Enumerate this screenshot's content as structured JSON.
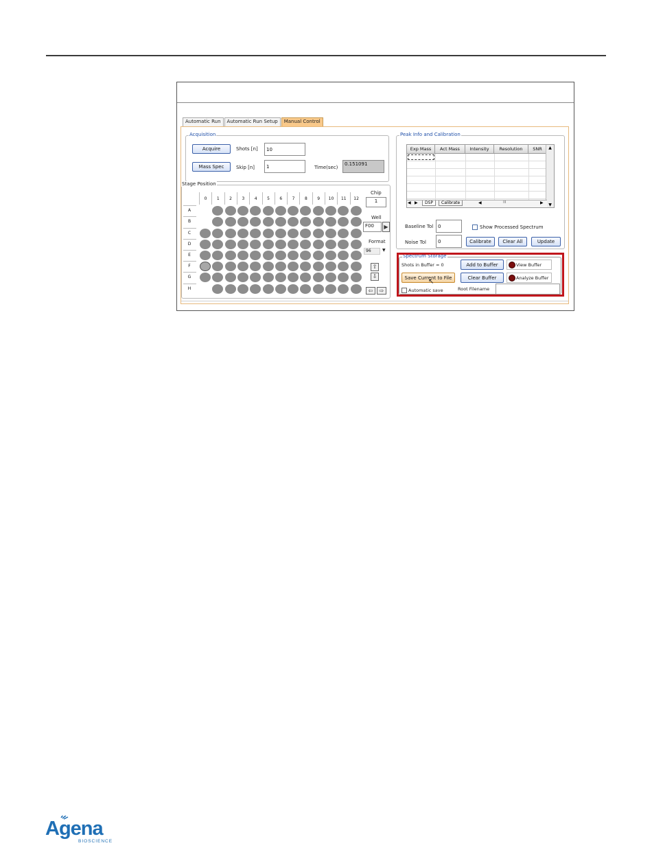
{
  "tabs": [
    "Automatic Run",
    "Automatic Run Setup",
    "Manual Control"
  ],
  "acquisition": {
    "title": "Acquisition",
    "acquire_label": "Acquire",
    "mass_spec_label": "Mass Spec",
    "shots_label": "Shots [n]",
    "shots_value": "10",
    "skip_label": "Skip [n]",
    "skip_value": "1",
    "time_label": "Time(sec)",
    "time_value": "0.151091"
  },
  "stage": {
    "title": "Stage Position",
    "columns": [
      "0",
      "1",
      "2",
      "3",
      "4",
      "5",
      "6",
      "7",
      "8",
      "9",
      "10",
      "11",
      "12"
    ],
    "rows": [
      "A",
      "B",
      "C",
      "D",
      "E",
      "F",
      "G",
      "H"
    ],
    "selected_well": "F0",
    "chip_label": "Chip",
    "chip_value": "1",
    "well_label": "Well",
    "well_value": "F00",
    "format_label": "Format",
    "format_value": "96"
  },
  "peak": {
    "title": "Peak Info and Calibration",
    "columns": [
      "Exp Mass",
      "Act Mass",
      "Intensity",
      "Resolution",
      "SNR"
    ],
    "subtabs": [
      "DSP",
      "Calibrate"
    ],
    "baseline_label": "Baseline Tol",
    "baseline_value": "0",
    "noise_label": "Noise Tol",
    "noise_value": "0",
    "show_processed_label": "Show Processed Spectrum",
    "calibrate_label": "Calibrate",
    "clear_all_label": "Clear All",
    "update_label": "Update",
    "scroll_glyph": "III"
  },
  "storage": {
    "title": "Spectrum Storage",
    "shots_in_buffer": "Shots in Buffer = 0",
    "add_to_buffer": "Add to Buffer",
    "view_buffer": "View Buffer",
    "save_current": "Save Current to File",
    "clear_buffer": "Clear Buffer",
    "analyze_buffer": "Analyze Buffer",
    "automatic_save": "Automatic save",
    "root_filename_label": "Root Filename",
    "root_filename_value": ""
  },
  "logo": {
    "brand": "Agena",
    "sub": "BIOSCIENCE"
  },
  "colors": {
    "highlight": "#c0161c",
    "active_tab": "#f9c98a",
    "group_title": "#1f4fa8",
    "well": "#8c8c8c",
    "brand": "#1f6fb5"
  }
}
